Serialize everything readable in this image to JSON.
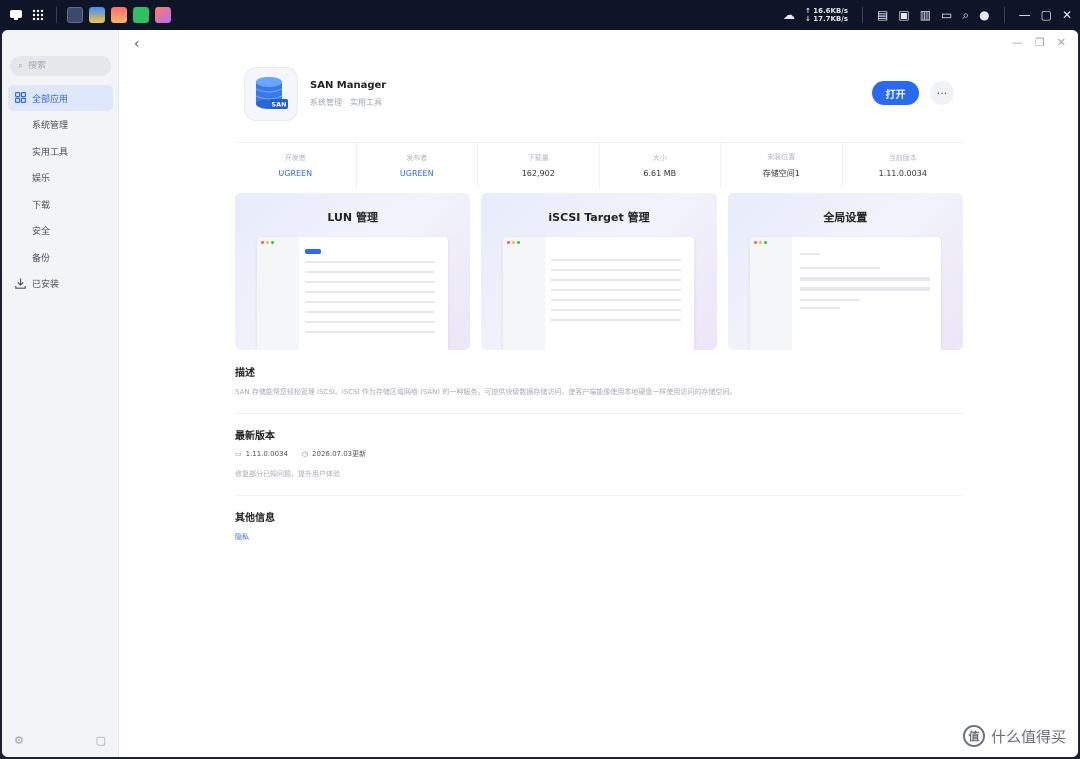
{
  "topbar": {
    "network_up": "↑ 16.6KB/s",
    "network_down": "↓ 17.7KB/s"
  },
  "sidebar": {
    "search_placeholder": "搜索",
    "items": [
      {
        "label": "全部应用",
        "icon": "grid-icon",
        "active": true
      },
      {
        "label": "系统管理",
        "icon": "",
        "active": false
      },
      {
        "label": "实用工具",
        "icon": "",
        "active": false
      },
      {
        "label": "娱乐",
        "icon": "",
        "active": false
      },
      {
        "label": "下载",
        "icon": "",
        "active": false
      },
      {
        "label": "安全",
        "icon": "",
        "active": false
      },
      {
        "label": "备份",
        "icon": "",
        "active": false
      },
      {
        "label": "已安装",
        "icon": "download-icon",
        "active": false
      }
    ]
  },
  "app": {
    "name": "SAN Manager",
    "categories": [
      "系统管理",
      "实用工具"
    ],
    "icon_label": "SAN",
    "open_label": "打开",
    "more_label": "···"
  },
  "info": [
    {
      "label": "开发者",
      "value": "UGREEN",
      "link": true
    },
    {
      "label": "发布者",
      "value": "UGREEN",
      "link": true
    },
    {
      "label": "下载量",
      "value": "162,902",
      "link": false
    },
    {
      "label": "大小",
      "value": "6.61 MB",
      "link": false
    },
    {
      "label": "安装位置",
      "value": "存储空间1",
      "link": false
    },
    {
      "label": "当前版本",
      "value": "1.11.0.0034",
      "link": false
    }
  ],
  "screenshots": [
    {
      "title": "LUN 管理"
    },
    {
      "title": "iSCSI Target 管理"
    },
    {
      "title": "全局设置"
    }
  ],
  "description": {
    "title": "描述",
    "text": "SAN 存储能帮您轻松管理 iSCSI。iSCSI 作为存储区域网络 (SAN) 的一种服务，可提供块级数据存储访问，使客户端能像使用本地硬盘一样使用访问的存储空间。"
  },
  "latest": {
    "title": "最新版本",
    "version": "1.11.0.0034",
    "date": "2026.07.03更新",
    "notes": "修复部分已知问题，提升用户体验"
  },
  "other": {
    "title": "其他信息",
    "link": "隐私"
  },
  "watermark": {
    "text": "什么值得买",
    "icon_char": "值"
  }
}
